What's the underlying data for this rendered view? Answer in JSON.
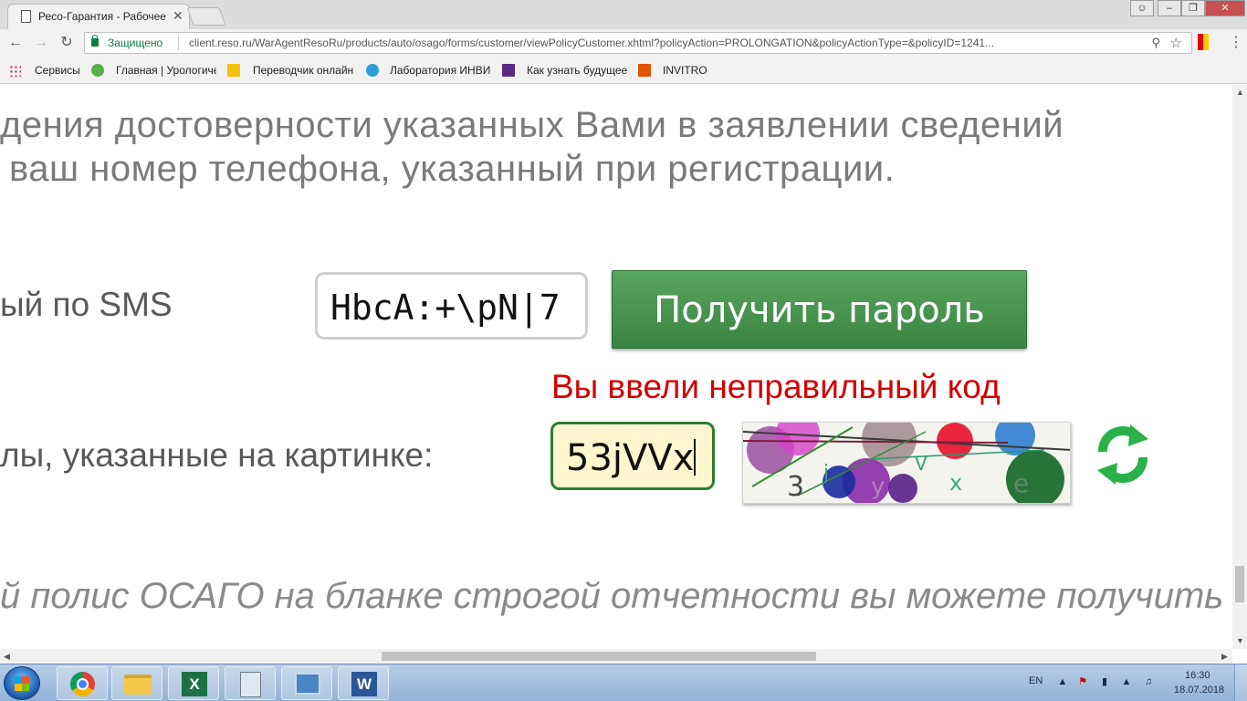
{
  "browser": {
    "tab_title": "Ресо-Гарантия - Рабочее",
    "secure_label": "Защищено",
    "url": "client.reso.ru/WarAgentResoRu/products/auto/osago/forms/customer/viewPolicyCustomer.xhtml?policyAction=PROLONGATION&policyActionType=&policyID=1241...",
    "bookmarks": [
      {
        "label": "Сервисы"
      },
      {
        "label": "Главная | Урологиче"
      },
      {
        "label": "Переводчик онлайн"
      },
      {
        "label": "Лаборатория ИНВИ"
      },
      {
        "label": "Как узнать будущее"
      },
      {
        "label": "INVITRO"
      }
    ]
  },
  "page": {
    "intro_line1": "дения достоверности указанных Вами в заявлении сведений",
    "intro_line2": "ваш номер телефона, указанный при регистрации.",
    "sms_label": "ый по SMS",
    "sms_input_value": "HbcA:+\\pN|7",
    "get_password_button": "Получить пароль",
    "error_message": "Вы ввели неправильный код",
    "captcha_label": "лы, указанные на картинке:",
    "captcha_input_value": "53jVVx",
    "captcha_chars": [
      "3",
      "j",
      "y",
      "V",
      "x",
      "e"
    ],
    "outro": "й полис ОСАГО на бланке строгой отчетности вы можете получить"
  },
  "taskbar": {
    "apps": [
      "chrome",
      "explorer",
      "excel",
      "calculator",
      "network",
      "word"
    ],
    "language": "EN",
    "time": "16:30",
    "date": "18.07.2018"
  },
  "colors": {
    "button_green": "#3a8443",
    "error_red": "#d40000",
    "captcha_border": "#2e7d32",
    "captcha_bg": "#fff5cf"
  }
}
